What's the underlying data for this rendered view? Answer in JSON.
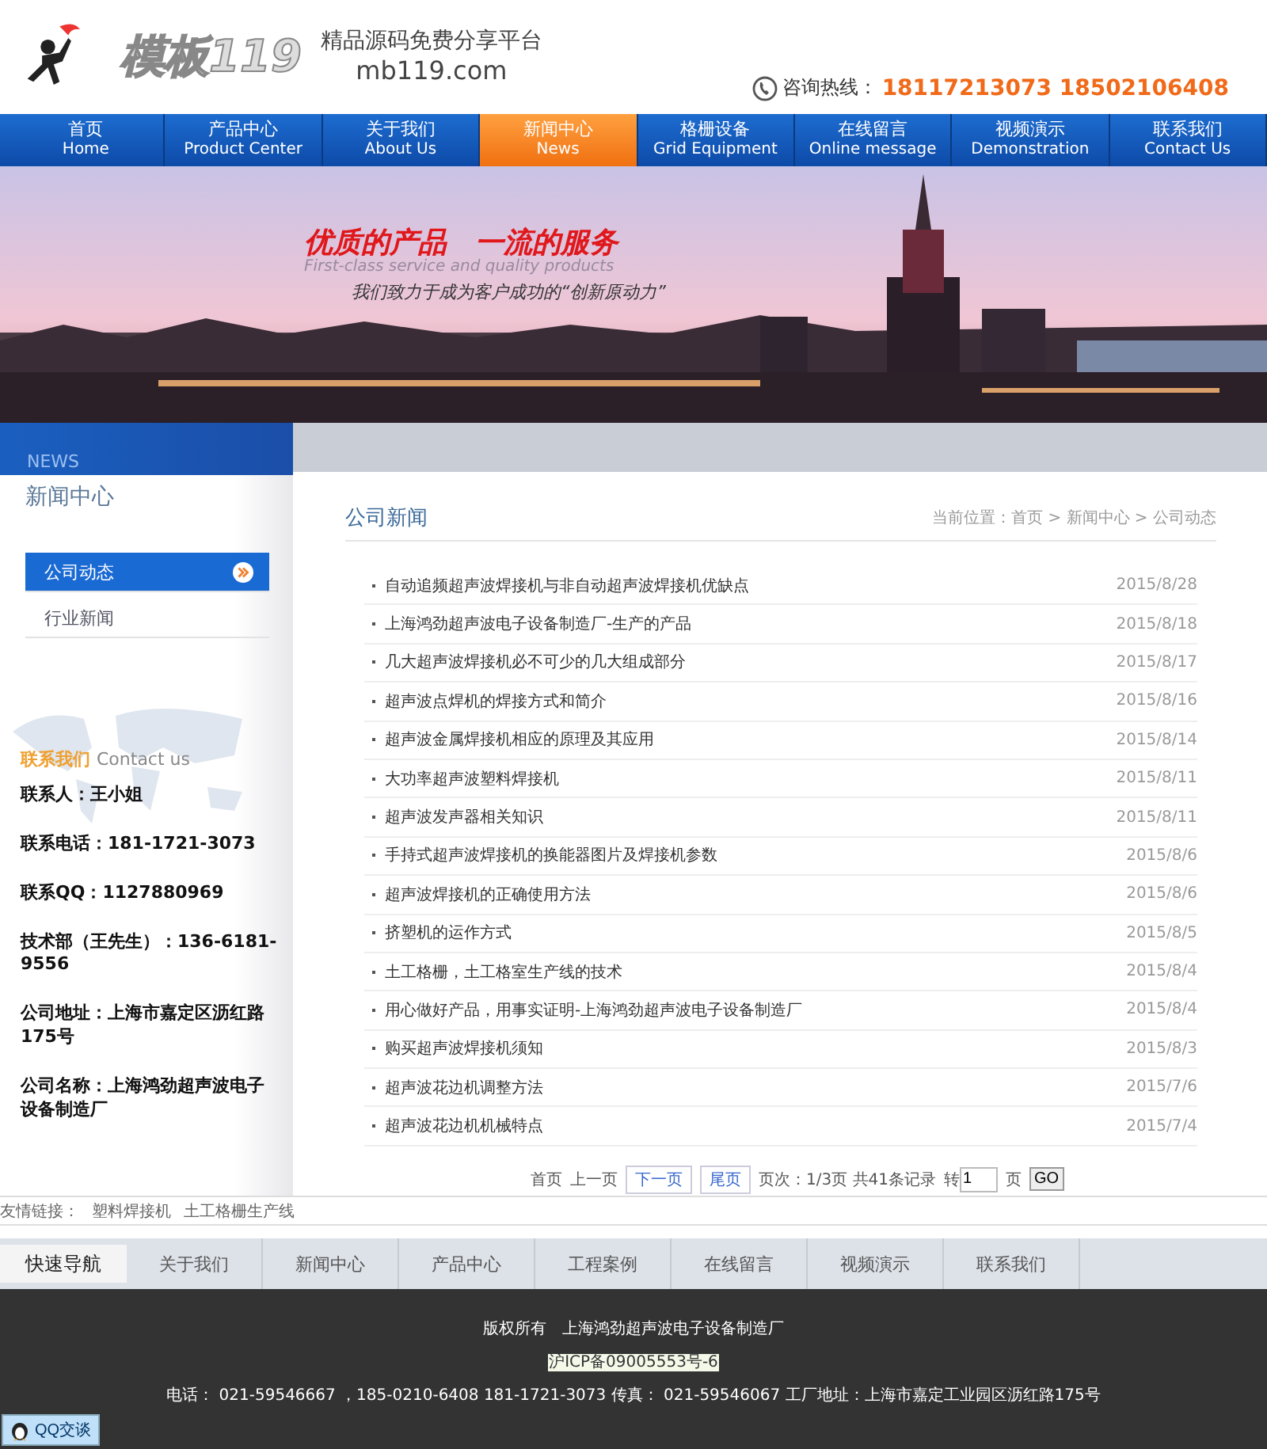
{
  "header": {
    "logo_text": "模板119",
    "tagline": "精品源码免费分享平台",
    "domain": "mb119.com",
    "hotline_label": "咨询热线：",
    "hotline_numbers": "18117213073 18502106408"
  },
  "nav": [
    {
      "cn": "首页",
      "en": "Home",
      "selected": false
    },
    {
      "cn": "产品中心",
      "en": "Product Center",
      "selected": false
    },
    {
      "cn": "关于我们",
      "en": "About Us",
      "selected": false
    },
    {
      "cn": "新闻中心",
      "en": "News",
      "selected": true
    },
    {
      "cn": "格栅设备",
      "en": "Grid Equipment",
      "selected": false
    },
    {
      "cn": "在线留言",
      "en": "Online message",
      "selected": false
    },
    {
      "cn": "视频演示",
      "en": "Demonstration",
      "selected": false
    },
    {
      "cn": "联系我们",
      "en": "Contact Us",
      "selected": false
    }
  ],
  "banner": {
    "kind": "picture",
    "slogan": "优质的产品　一流的服务",
    "slogan_en": "First-class service and quality products",
    "subline": "我们致力于成为客户成功的“创新原动力”"
  },
  "sidebar": {
    "tag": "NEWS",
    "title": "新闻中心",
    "items": [
      {
        "label": "公司动态",
        "selected": true
      },
      {
        "label": "行业新闻",
        "selected": false
      }
    ],
    "contact_title": "联系我们",
    "contact_title_en": "Contact us",
    "contact_lines": [
      "联系人：王小姐",
      "联系电话：181-1721-3073",
      "联系QQ：1127880969",
      "技术部（王先生）：136-6181-9556",
      "公司地址：上海市嘉定区沥红路175号",
      "公司名称：上海鸿劲超声波电子设备制造厂"
    ]
  },
  "content": {
    "title": "公司新闻",
    "breadcrumb": "当前位置：首页 > 新闻中心 > 公司动态",
    "news": [
      {
        "title": "自动追频超声波焊接机与非自动超声波焊接机优缺点",
        "date": "2015/8/28"
      },
      {
        "title": "上海鸿劲超声波电子设备制造厂-生产的产品",
        "date": "2015/8/18"
      },
      {
        "title": "几大超声波焊接机必不可少的几大组成部分",
        "date": "2015/8/17"
      },
      {
        "title": "超声波点焊机的焊接方式和简介",
        "date": "2015/8/16"
      },
      {
        "title": "超声波金属焊接机相应的原理及其应用",
        "date": "2015/8/14"
      },
      {
        "title": "大功率超声波塑料焊接机",
        "date": "2015/8/11"
      },
      {
        "title": "超声波发声器相关知识",
        "date": "2015/8/11"
      },
      {
        "title": "手持式超声波焊接机的换能器图片及焊接机参数",
        "date": "2015/8/6"
      },
      {
        "title": "超声波焊接机的正确使用方法",
        "date": "2015/8/6"
      },
      {
        "title": "挤塑机的运作方式",
        "date": "2015/8/5"
      },
      {
        "title": "土工格栅，土工格室生产线的技术",
        "date": "2015/8/4"
      },
      {
        "title": "用心做好产品，用事实证明-上海鸿劲超声波电子设备制造厂",
        "date": "2015/8/4"
      },
      {
        "title": "购买超声波焊接机须知",
        "date": "2015/8/3"
      },
      {
        "title": "超声波花边机调整方法",
        "date": "2015/7/6"
      },
      {
        "title": "超声波花边机机械特点",
        "date": "2015/7/4"
      }
    ],
    "pagination": {
      "first": "首页",
      "prev": "上一页",
      "next": "下一页",
      "last": "尾页",
      "info": "页次：1/3页 共41条记录",
      "goto_label": "转",
      "page_value": "1",
      "page_suffix": "页",
      "go": "GO"
    }
  },
  "friend_links": {
    "label": "友情链接：",
    "links": [
      "塑料焊接机",
      "土工格栅生产线"
    ]
  },
  "quick_nav": {
    "title": "快速导航",
    "links": [
      "关于我们",
      "新闻中心",
      "产品中心",
      "工程案例",
      "在线留言",
      "视频演示",
      "联系我们"
    ]
  },
  "footer": {
    "copyright": "版权所有　上海鸿劲超声波电子设备制造厂",
    "icp": "沪ICP备09005553号-6",
    "contact": "电话：  021-59546667 ，185-0210-6408 181-1721-3073 传真：  021-59546067 工厂地址：上海市嘉定工业园区沥红路175号"
  },
  "qq_button": "QQ交谈"
}
